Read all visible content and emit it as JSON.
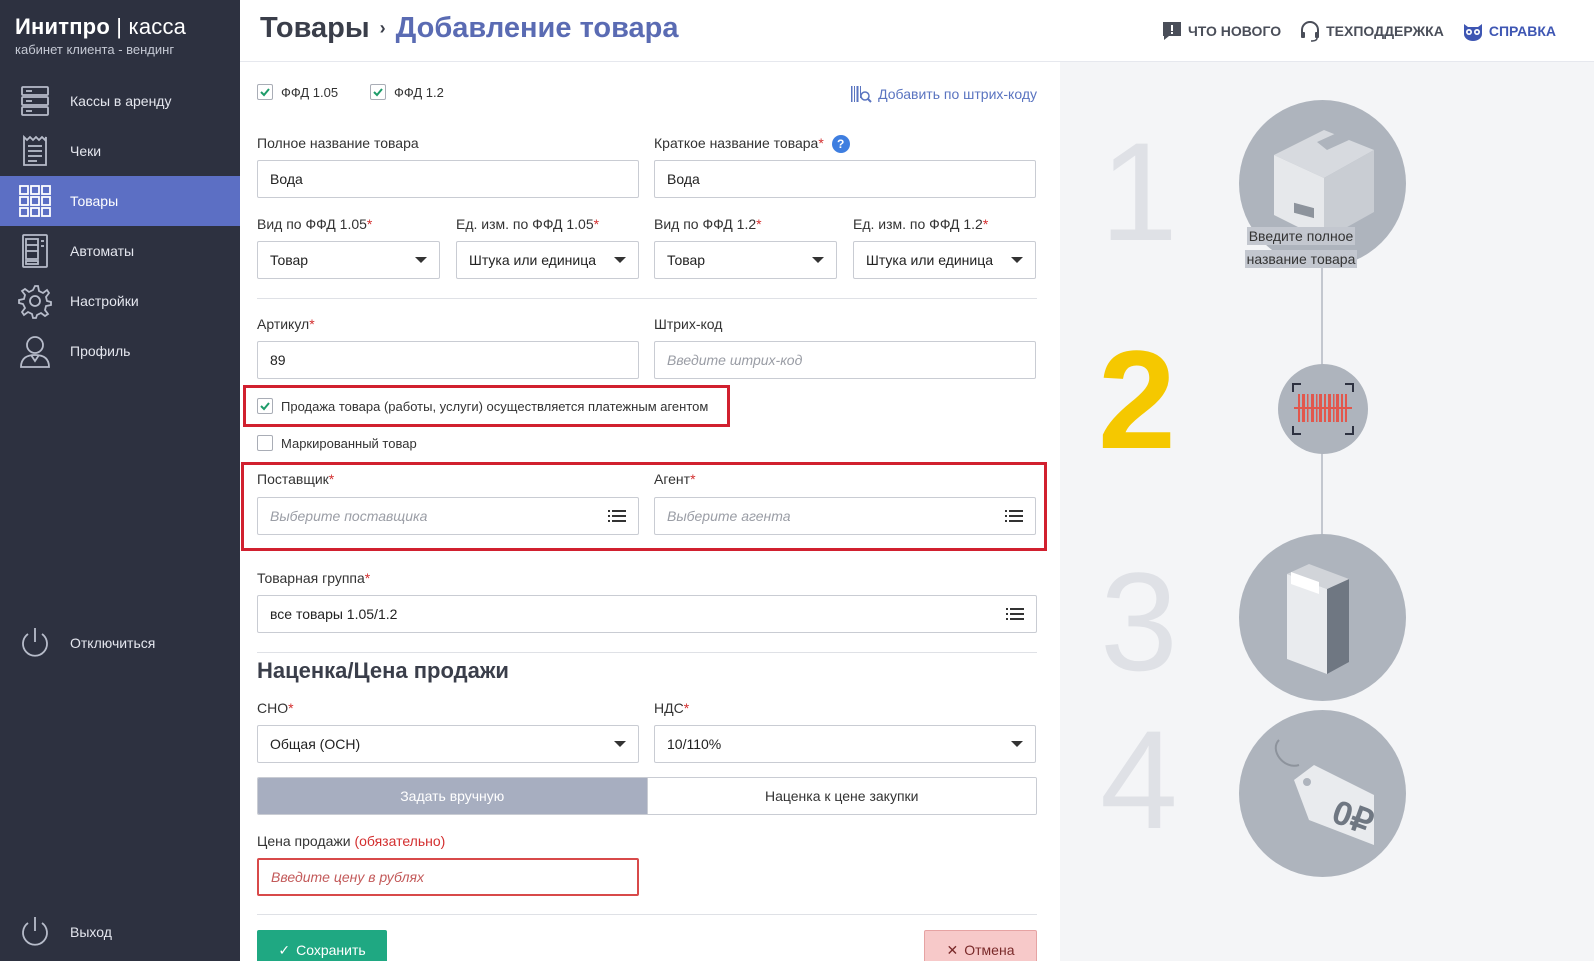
{
  "brand": {
    "name": "Инитпро",
    "separator": "|",
    "product": "касса",
    "subtitle": "кабинет клиента - вендинг"
  },
  "sidebar": {
    "items": [
      {
        "label": "Кассы в аренду",
        "icon": "server-rack-icon",
        "active": false
      },
      {
        "label": "Чеки",
        "icon": "receipt-icon",
        "active": false
      },
      {
        "label": "Товары",
        "icon": "grid-icon",
        "active": true
      },
      {
        "label": "Автоматы",
        "icon": "vending-machine-icon",
        "active": false
      },
      {
        "label": "Настройки",
        "icon": "gear-icon",
        "active": false
      },
      {
        "label": "Профиль",
        "icon": "user-icon",
        "active": false
      }
    ],
    "disconnect_label": "Отключиться",
    "logout_label": "Выход"
  },
  "header": {
    "breadcrumb_root": "Товары",
    "breadcrumb_sep": "›",
    "breadcrumb_current": "Добавление товара",
    "links": {
      "whats_new": "ЧТО НОВОГО",
      "support": "ТЕХПОДДЕРЖКА",
      "help": "СПРАВКА"
    }
  },
  "form": {
    "ffd105_label": "ФФД 1.05",
    "ffd12_label": "ФФД 1.2",
    "add_by_barcode": "Добавить по штрих-коду",
    "full_name_label": "Полное название товара",
    "full_name_value": "Вода",
    "short_name_label": "Краткое название товара",
    "short_name_value": "Вода",
    "help_q": "?",
    "req": "*",
    "kind105_label": "Вид по ФФД 1.05",
    "kind105_value": "Товар",
    "unit105_label": "Ед. изм. по ФФД 1.05",
    "unit105_value": "Штука или единица",
    "kind12_label": "Вид по ФФД 1.2",
    "kind12_value": "Товар",
    "unit12_label": "Ед. изм. по ФФД 1.2",
    "unit12_value": "Штука или единица",
    "article_label": "Артикул",
    "article_value": "89",
    "barcode_label": "Штрих-код",
    "barcode_placeholder": "Введите штрих-код",
    "agent_sale_label": "Продажа товара (работы, услуги) осуществляется платежным агентом",
    "marked_label": "Маркированный товар",
    "supplier_label": "Поставщик",
    "supplier_placeholder": "Выберите поставщика",
    "agent_label": "Агент",
    "agent_placeholder": "Выберите агента",
    "group_label": "Товарная группа",
    "group_value": "все товары 1.05/1.2",
    "section_title": "Наценка/Цена продажи",
    "sno_label": "СНО",
    "sno_value": "Общая (ОСН)",
    "vat_label": "НДС",
    "vat_value": "10/110%",
    "mode_manual": "Задать вручную",
    "mode_markup": "Наценка к цене закупки",
    "price_label": "Цена продажи",
    "price_required": "(обязательно)",
    "price_placeholder": "Введите цену в рублях",
    "save_label": "Сохранить",
    "cancel_label": "Отмена"
  },
  "steps": {
    "n1": "1",
    "n2": "2",
    "n3": "3",
    "n4": "4",
    "step1_caption_line1": "Введите полное",
    "step1_caption_line2": "название товара",
    "price_tag_text": "0₽"
  },
  "colors": {
    "sidebar_bg": "#2d3140",
    "active_nav": "#5c6fc4",
    "accent_blue": "#5a6bb3",
    "highlight_red": "#d1202f",
    "step_active": "#f5c800",
    "save_green": "#1fa882"
  }
}
